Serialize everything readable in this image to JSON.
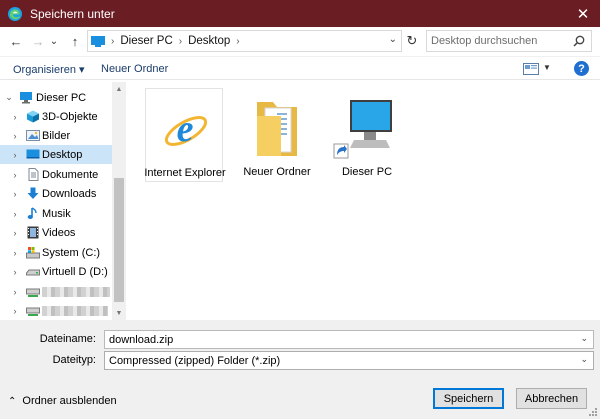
{
  "window": {
    "title": "Speichern unter",
    "close_glyph": "✕",
    "icon": "edge-icon"
  },
  "nav": {
    "back_glyph": "←",
    "forward_glyph": "→",
    "recent_glyph": "⌄",
    "up_glyph": "↑",
    "refresh_glyph": "↻",
    "address_dropdown_glyph": "⌄",
    "breadcrumbs": [
      "Dieser PC",
      "Desktop"
    ],
    "crumb_sep": "›",
    "search_placeholder": "Desktop durchsuchen"
  },
  "toolbar": {
    "organize_label": "Organisieren ▾",
    "new_folder_label": "Neuer Ordner",
    "view_caret": "▼",
    "help_glyph": "?"
  },
  "tree": {
    "items": [
      {
        "label": "Dieser PC",
        "icon": "computer-icon",
        "arrow": "⌄"
      },
      {
        "label": "3D-Objekte",
        "icon": "cube-icon",
        "arrow": "›"
      },
      {
        "label": "Bilder",
        "icon": "pictures-icon",
        "arrow": "›"
      },
      {
        "label": "Desktop",
        "icon": "desktop-icon",
        "arrow": "›"
      },
      {
        "label": "Dokumente",
        "icon": "document-icon",
        "arrow": "›"
      },
      {
        "label": "Downloads",
        "icon": "download-icon",
        "arrow": "›"
      },
      {
        "label": "Musik",
        "icon": "music-icon",
        "arrow": "›"
      },
      {
        "label": "Videos",
        "icon": "video-icon",
        "arrow": "›"
      },
      {
        "label": "System (C:)",
        "icon": "system-drive-icon",
        "arrow": "›"
      },
      {
        "label": "Virtuell D (D:)",
        "icon": "drive-icon",
        "arrow": "›"
      },
      {
        "label": "",
        "icon": "network-drive-icon",
        "arrow": "›"
      },
      {
        "label": "",
        "icon": "network-drive-icon",
        "arrow": "›"
      }
    ],
    "selected_index": 3,
    "scroll_up_glyph": "▲",
    "scroll_down_glyph": "▼"
  },
  "files": [
    {
      "label": "Internet Explorer",
      "icon": "internet-explorer-icon"
    },
    {
      "label": "Neuer Ordner",
      "icon": "folder-icon"
    },
    {
      "label": "Dieser PC",
      "icon": "computer-shortcut-icon"
    }
  ],
  "form": {
    "filename_label": "Dateiname:",
    "filename_value": "download.zip",
    "filetype_label": "Dateityp:",
    "filetype_value": "Compressed (zipped) Folder (*.zip)",
    "caret_glyph": "⌄"
  },
  "footer": {
    "hide_folders_label": "Ordner ausblenden",
    "hide_folders_glyph": "⌃",
    "save_label": "Speichern",
    "cancel_label": "Abbrechen"
  },
  "colors": {
    "titlebar": "#6b1d24",
    "selection": "#cce4f7",
    "accent": "#0078d7"
  }
}
